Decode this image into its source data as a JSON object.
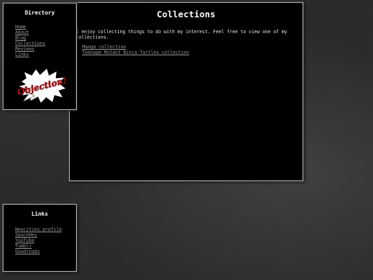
{
  "main": {
    "title": "Collections",
    "intro": "I enjoy collecting things to do with my interest. Feel free to view one of my collections.",
    "links": [
      {
        "label": "Manga collection"
      },
      {
        "label": "Teenage Mutant Ninja Turtles collection"
      }
    ]
  },
  "directory": {
    "title": "Directory",
    "items": [
      {
        "label": "Home"
      },
      {
        "label": "About"
      },
      {
        "label": "Blog"
      },
      {
        "label": "Collections"
      },
      {
        "label": "Reviews"
      },
      {
        "label": "Links"
      }
    ],
    "logo": {
      "icon": "objection-speech-bubble",
      "text": "Objection!",
      "colors": {
        "text": "#d0141b",
        "bubble": "#ffffff"
      }
    }
  },
  "links": {
    "title": "Links",
    "items": [
      {
        "label": "Neocities profile"
      },
      {
        "label": "SpaceHey"
      },
      {
        "label": "YouTube"
      },
      {
        "label": "Tumblr"
      },
      {
        "label": "Goodreads"
      }
    ]
  },
  "colors": {
    "panel_bg": "#000000",
    "panel_border": "#b9b9b9",
    "link": "#9a9a9a",
    "text": "#e8e8e8"
  }
}
